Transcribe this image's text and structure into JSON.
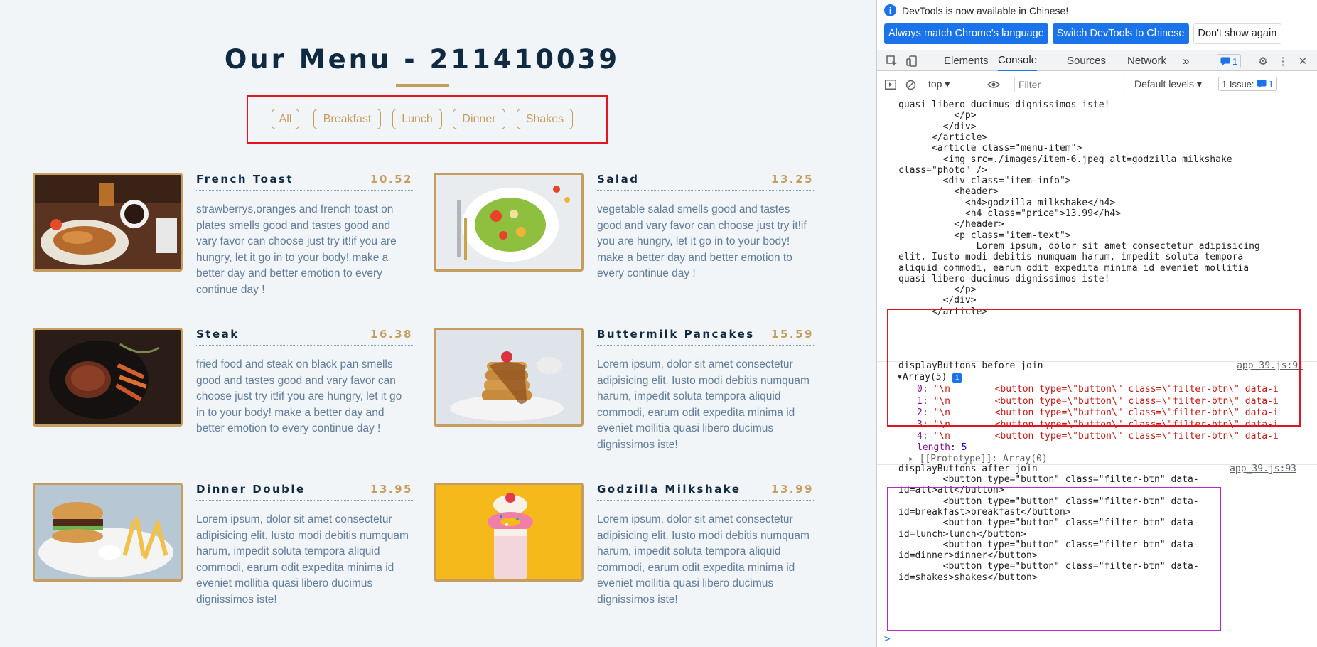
{
  "menu": {
    "title": "Our Menu - 211410039",
    "filters": [
      "All",
      "Breakfast",
      "Lunch",
      "Dinner",
      "Shakes"
    ],
    "items": [
      {
        "name": "French Toast",
        "price": "10.52",
        "text": "strawberrys,oranges and french toast on plates smells good and tastes good and vary favor can choose just try it!if you are hungry, let it go in to your body! make a better day and better emotion to every continue day !"
      },
      {
        "name": "Salad",
        "price": "13.25",
        "text": "vegetable salad smells good and tastes good and vary favor can choose just try it!if you are hungry, let it go in to your body! make a better day and better emotion to every continue day !"
      },
      {
        "name": "Steak",
        "price": "16.38",
        "text": "fried food and steak on black pan smells good and tastes good and vary favor can choose just try it!if you are hungry, let it go in to your body! make a better day and better emotion to every continue day !"
      },
      {
        "name": "Buttermilk Pancakes",
        "price": "15.59",
        "text": "Lorem ipsum, dolor sit amet consectetur adipisicing elit. Iusto modi debitis numquam harum, impedit soluta tempora aliquid commodi, earum odit expedita minima id eveniet mollitia quasi libero ducimus dignissimos iste!"
      },
      {
        "name": "Dinner Double",
        "price": "13.95",
        "text": "Lorem ipsum, dolor sit amet consectetur adipisicing elit. Iusto modi debitis numquam harum, impedit soluta tempora aliquid commodi, earum odit expedita minima id eveniet mollitia quasi libero ducimus dignissimos iste!"
      },
      {
        "name": "Godzilla Milkshake",
        "price": "13.99",
        "text": "Lorem ipsum, dolor sit amet consectetur adipisicing elit. Iusto modi debitis numquam harum, impedit soluta tempora aliquid commodi, earum odit expedita minima id eveniet mollitia quasi libero ducimus dignissimos iste!"
      }
    ]
  },
  "devtools": {
    "info_text": "DevTools is now available in Chinese!",
    "info_buttons": [
      "Always match Chrome's language",
      "Switch DevTools to Chinese",
      "Don't show again"
    ],
    "tabs": [
      "Elements",
      "Console",
      "Sources",
      "Network"
    ],
    "more_tabs": "»",
    "message_badge": "1",
    "toolbar": {
      "context": "top",
      "filter_placeholder": "Filter",
      "levels": "Default levels",
      "issues_label": "1 Issue:",
      "issues_count": "1"
    },
    "console_lines": [
      "quasi libero ducimus dignissimos iste!",
      "          </p>",
      "        </div>",
      "      </article>",
      "      <article class=\"menu-item\">",
      "        <img src=./images/item-6.jpeg alt=godzilla milkshake",
      "class=\"photo\" />",
      "        <div class=\"item-info\">",
      "          <header>",
      "            <h4>godzilla milkshake</h4>",
      "            <h4 class=\"price\">13.99</h4>",
      "          </header>",
      "          <p class=\"item-text\">",
      "              Lorem ipsum, dolor sit amet consectetur adipisicing",
      "elit. Iusto modi debitis numquam harum, impedit soluta tempora",
      "aliquid commodi, earum odit expedita minima id eveniet mollitia",
      "quasi libero ducimus dignissimos iste!",
      "          </p>",
      "        </div>",
      "      </article>"
    ],
    "log1": {
      "label": "displayButtons before join",
      "source": "app_39.js:91",
      "array_label": "Array(5)",
      "entry_text": "\"\\n        <button type=\\\"button\\\" class=\\\"filter-btn\\\" data-i",
      "indices": [
        "0",
        "1",
        "2",
        "3",
        "4"
      ],
      "length_key": "length",
      "length_value": "5",
      "prototype": "[[Prototype]]: Array(0)"
    },
    "log2": {
      "label": "displayButtons after join",
      "source": "app_39.js:93",
      "lines": [
        "        <button type=\"button\" class=\"filter-btn\" data-",
        "id=all>all</button>",
        "        <button type=\"button\" class=\"filter-btn\" data-",
        "id=breakfast>breakfast</button>",
        "        <button type=\"button\" class=\"filter-btn\" data-",
        "id=lunch>lunch</button>",
        "        <button type=\"button\" class=\"filter-btn\" data-",
        "id=dinner>dinner</button>",
        "        <button type=\"button\" class=\"filter-btn\" data-",
        "id=shakes>shakes</button>"
      ]
    },
    "prompt": ">"
  },
  "colors": {
    "accent": "#c59d5f",
    "heading": "#102a42",
    "body_text": "#617d98",
    "highlight_red": "#e3141f",
    "highlight_purple": "#b02bc9",
    "devtools_blue": "#1a73e8"
  }
}
